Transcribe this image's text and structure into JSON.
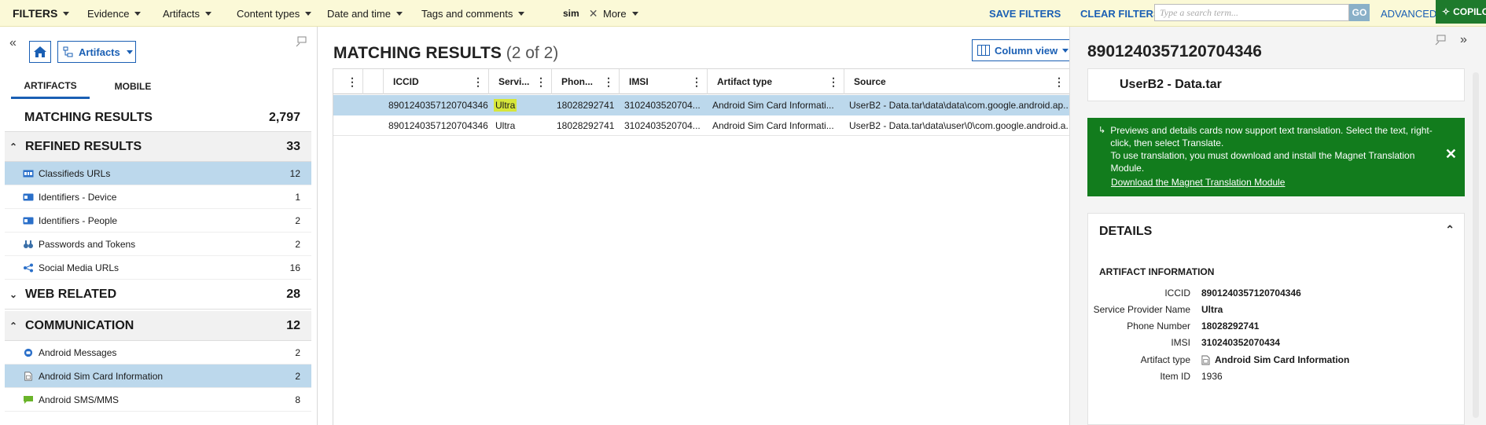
{
  "topbar": {
    "filters_label": "FILTERS",
    "menus": [
      "Evidence",
      "Artifacts",
      "Content types",
      "Date and time",
      "Tags and comments"
    ],
    "active_term": "sim",
    "more_label": "More",
    "save_filters": "SAVE FILTERS",
    "clear_filters": "CLEAR FILTERS",
    "search_placeholder": "Type a search term...",
    "go_label": "GO",
    "advanced_label": "ADVANCED",
    "copilot_label": "COPILOT",
    "accent": "#1a5fb4",
    "bar_color": "#fbf9d7"
  },
  "left": {
    "view_dropdown": "Artifacts",
    "tabs": [
      "ARTIFACTS",
      "MOBILE"
    ],
    "matching_label": "MATCHING RESULTS",
    "matching_count": "2,797",
    "sections": [
      {
        "label": "REFINED RESULTS",
        "count": "33",
        "expanded": true,
        "items": [
          {
            "label": "Classifieds URLs",
            "count": "12",
            "icon": "classifieds-icon",
            "selected": true
          },
          {
            "label": "Identifiers - Device",
            "count": "1",
            "icon": "id-card-icon"
          },
          {
            "label": "Identifiers - People",
            "count": "2",
            "icon": "id-card-icon"
          },
          {
            "label": "Passwords and Tokens",
            "count": "2",
            "icon": "binoculars-icon"
          },
          {
            "label": "Social Media URLs",
            "count": "16",
            "icon": "share-icon"
          }
        ]
      },
      {
        "label": "WEB RELATED",
        "count": "28",
        "expanded": false,
        "items": []
      },
      {
        "label": "COMMUNICATION",
        "count": "12",
        "expanded": true,
        "items": [
          {
            "label": "Android Messages",
            "count": "2",
            "icon": "android-messages-icon"
          },
          {
            "label": "Android Sim Card Information",
            "count": "2",
            "icon": "sim-card-icon",
            "selected": true
          },
          {
            "label": "Android SMS/MMS",
            "count": "8",
            "icon": "sms-icon"
          }
        ]
      }
    ]
  },
  "middle": {
    "title": "MATCHING RESULTS",
    "count_text": "(2 of 2)",
    "column_view_label": "Column view",
    "columns": [
      "ICCID",
      "Servi...",
      "Phon...",
      "IMSI",
      "Artifact type",
      "Source"
    ],
    "rows": [
      {
        "iccid": "8901240357120704346",
        "service": "Ultra",
        "phone": "18028292741",
        "imsi": "3102403520704...",
        "type": "Android Sim Card Informati...",
        "source": "UserB2 - Data.tar\\data\\data\\com.google.android.ap...",
        "selected": true
      },
      {
        "iccid": "8901240357120704346",
        "service": "Ultra",
        "phone": "18028292741",
        "imsi": "3102403520704...",
        "type": "Android Sim Card Informati...",
        "source": "UserB2 - Data.tar\\data\\user\\0\\com.google.android.a..."
      }
    ],
    "highlight_color": "#d6e63a"
  },
  "right": {
    "title": "8901240357120704346",
    "card_title": "UserB2 - Data.tar",
    "banner_lines": [
      "Previews and details cards now support text translation. Select the text, right-click, then select Translate.",
      "To use translation, you must download and install the Magnet Translation Module."
    ],
    "banner_link": "Download the Magnet Translation Module",
    "banner_color": "#127c1d",
    "details_label": "DETAILS",
    "artifact_info_label": "ARTIFACT INFORMATION",
    "fields": [
      {
        "key": "ICCID",
        "value": "8901240357120704346"
      },
      {
        "key": "Service Provider Name",
        "value": "Ultra"
      },
      {
        "key": "Phone Number",
        "value": "18028292741"
      },
      {
        "key": "IMSI",
        "value": "310240352070434"
      },
      {
        "key": "Artifact type",
        "value": "Android Sim Card Information"
      },
      {
        "key": "Item ID",
        "value": "1936"
      }
    ]
  }
}
